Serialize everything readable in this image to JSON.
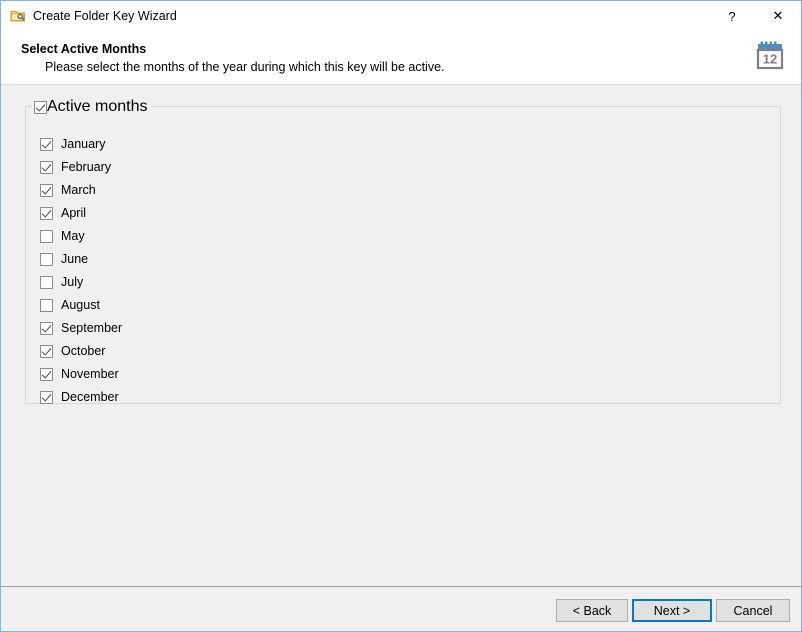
{
  "window": {
    "title": "Create Folder Key Wizard",
    "icon": "folder-key-icon",
    "help_label": "?",
    "close_label": "✕"
  },
  "header": {
    "title": "Select Active Months",
    "subtitle": "Please select the months of the year during which this key will be active.",
    "icon": "calendar-12-icon",
    "icon_text": "12"
  },
  "group": {
    "caption": "Active months",
    "caption_checked": true,
    "months": [
      {
        "label": "January",
        "checked": true
      },
      {
        "label": "February",
        "checked": true
      },
      {
        "label": "March",
        "checked": true
      },
      {
        "label": "April",
        "checked": true
      },
      {
        "label": "May",
        "checked": false
      },
      {
        "label": "June",
        "checked": false
      },
      {
        "label": "July",
        "checked": false
      },
      {
        "label": "August",
        "checked": false
      },
      {
        "label": "September",
        "checked": true
      },
      {
        "label": "October",
        "checked": true
      },
      {
        "label": "November",
        "checked": true
      },
      {
        "label": "December",
        "checked": true
      }
    ]
  },
  "footer": {
    "back_label": "< Back",
    "next_label": "Next >",
    "cancel_label": "Cancel",
    "default_button": "next"
  },
  "colors": {
    "window_border": "#7EB4EA",
    "titlebar_bg": "#FFFFFF",
    "content_bg": "#F0F0F0",
    "groupbox_border": "#D7D7D7",
    "accent": "#0078D7",
    "calendar_blue": "#4A90C4",
    "calendar_gray": "#808080"
  }
}
